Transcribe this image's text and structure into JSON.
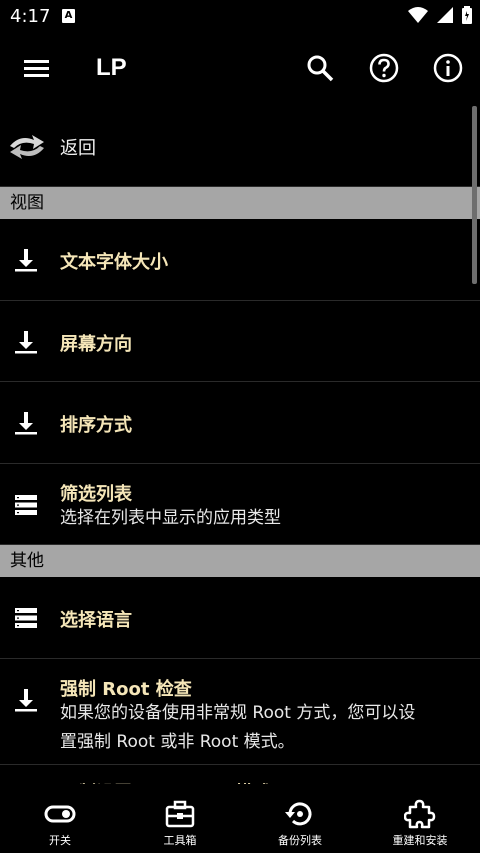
{
  "status": {
    "time": "4:17",
    "notif_letter": "A"
  },
  "app": {
    "title": "LP"
  },
  "rows": {
    "back": {
      "label": "返回"
    },
    "section_view": "视图",
    "text_size": {
      "label": "文本字体大小"
    },
    "orientation": {
      "label": "屏幕方向"
    },
    "sort": {
      "label": "排序方式"
    },
    "filter": {
      "label": "筛选列表",
      "sub": "选择在列表中显示的应用类型"
    },
    "section_other": "其他",
    "language": {
      "label": "选择语言"
    },
    "force_root": {
      "label": "强制 Root 检查",
      "sub": "如果您的设备使用非常规 Root 方式，您可以设置强制 Root 或非 Root 模式。"
    },
    "java_root": {
      "label": "强制设置 java root 模式"
    }
  },
  "nav": {
    "switch": "开关",
    "toolbox": "工具箱",
    "backup": "备份列表",
    "rebuild": "重建和安装"
  },
  "colors": {
    "accent_text": "#f5e6b8",
    "section_bg": "#a6a6a6"
  }
}
